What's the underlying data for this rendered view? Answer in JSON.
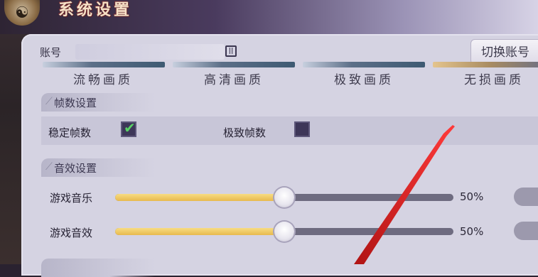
{
  "header": {
    "title": "系统设置",
    "logo_icon": "yin-yang-icon"
  },
  "account": {
    "label": "账号",
    "switch_button": "切换账号"
  },
  "quality": {
    "options": [
      {
        "label": "流畅画质",
        "selected": false
      },
      {
        "label": "高清画质",
        "selected": false
      },
      {
        "label": "极致画质",
        "selected": false
      },
      {
        "label": "无损画质",
        "selected": true
      }
    ]
  },
  "frame_settings": {
    "section_title": "帧数设置",
    "stable_label": "稳定帧数",
    "stable_checked": true,
    "extreme_label": "极致帧数",
    "extreme_checked": false
  },
  "audio_settings": {
    "section_title": "音效设置",
    "music_label": "游戏音乐",
    "music_value_text": "50%",
    "music_value": 50,
    "sfx_label": "游戏音效",
    "sfx_value_text": "50%",
    "sfx_value": 50
  },
  "colors": {
    "accent_fill": "#e8b94e",
    "check_green": "#58d066",
    "arrow_red": "#e01e1e"
  }
}
